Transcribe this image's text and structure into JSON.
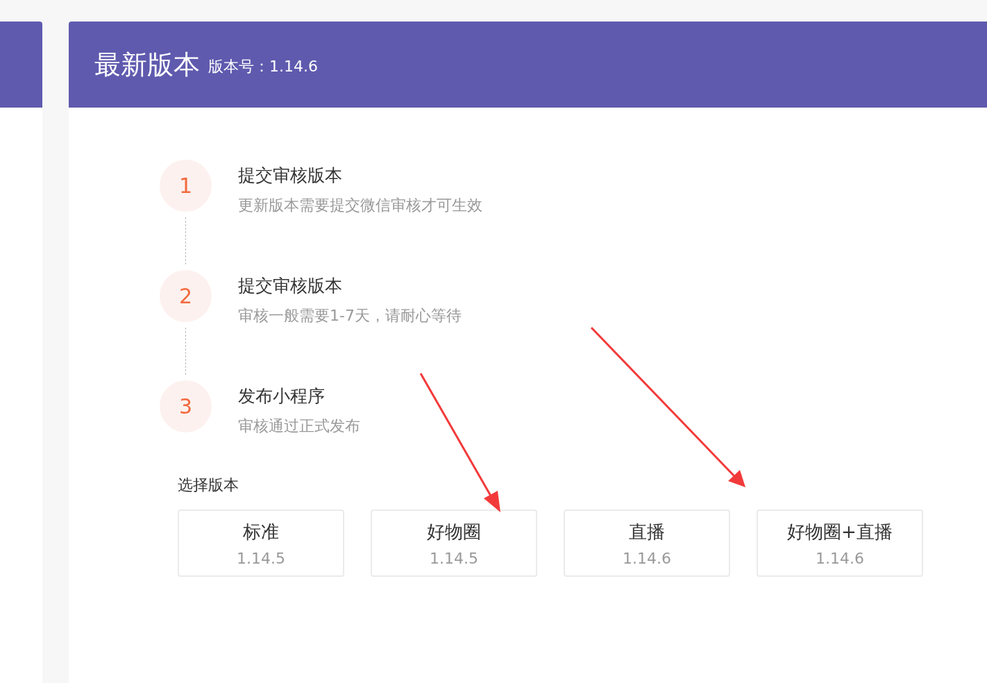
{
  "header": {
    "title": "最新版本",
    "version_label": "版本号：1.14.6"
  },
  "steps": [
    {
      "number": "1",
      "title": "提交审核版本",
      "description": "更新版本需要提交微信审核才可生效"
    },
    {
      "number": "2",
      "title": "提交审核版本",
      "description": "审核一般需要1-7天，请耐心等待"
    },
    {
      "number": "3",
      "title": "发布小程序",
      "description": "审核通过正式发布"
    }
  ],
  "version_select": {
    "label": "选择版本",
    "options": [
      {
        "name": "标准",
        "version": "1.14.5",
        "selected": false
      },
      {
        "name": "好物圈",
        "version": "1.14.5",
        "selected": false
      },
      {
        "name": "直播",
        "version": "1.14.6",
        "selected": false
      },
      {
        "name": "好物圈+直播",
        "version": "1.14.6",
        "selected": false
      }
    ]
  }
}
